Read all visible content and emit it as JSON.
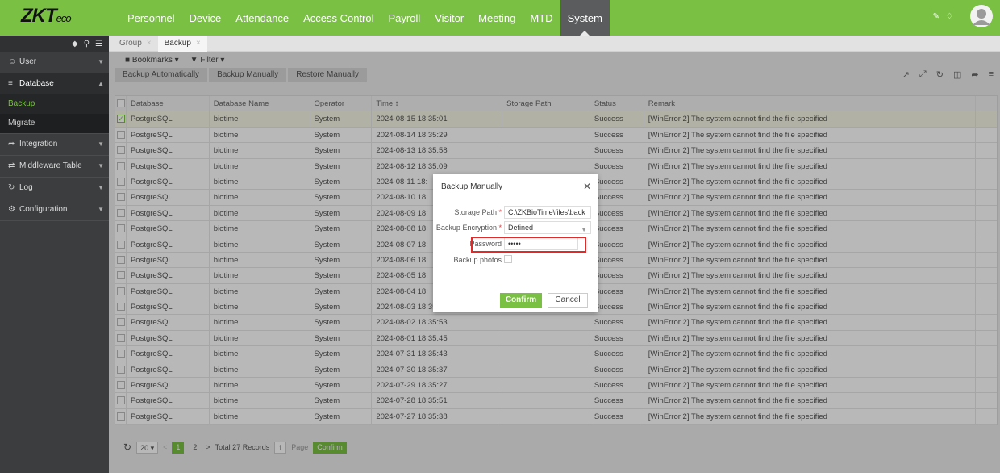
{
  "brand": {
    "logo": "ZKT",
    "logo_suffix": "eco",
    "accent": "#7ac143"
  },
  "nav": [
    {
      "label": "Personnel"
    },
    {
      "label": "Device"
    },
    {
      "label": "Attendance"
    },
    {
      "label": "Access Control"
    },
    {
      "label": "Payroll"
    },
    {
      "label": "Visitor"
    },
    {
      "label": "Meeting"
    },
    {
      "label": "MTD"
    },
    {
      "label": "System",
      "active": true
    }
  ],
  "sidebar": {
    "items": [
      {
        "label": "User",
        "icon": "users-icon"
      },
      {
        "label": "Database",
        "icon": "database-icon",
        "open": true,
        "children": [
          {
            "label": "Backup",
            "active": true
          },
          {
            "label": "Migrate"
          }
        ]
      },
      {
        "label": "Integration",
        "icon": "share-icon"
      },
      {
        "label": "Middleware Table",
        "icon": "exchange-icon"
      },
      {
        "label": "Log",
        "icon": "history-icon"
      },
      {
        "label": "Configuration",
        "icon": "gears-icon"
      }
    ]
  },
  "tabs": [
    {
      "label": "Group"
    },
    {
      "label": "Backup",
      "active": true
    }
  ],
  "toolbar": {
    "bookmarks": "Bookmarks",
    "filter": "Filter"
  },
  "sub_buttons": [
    "Backup Automatically",
    "Backup Manually",
    "Restore Manually"
  ],
  "table": {
    "columns": [
      "Database",
      "Database Name",
      "Operator",
      "Time ↕",
      "Storage Path",
      "Status",
      "Remark"
    ],
    "rows": [
      [
        "PostgreSQL",
        "biotime",
        "System",
        "2024-08-15 18:35:01",
        "",
        "Success",
        "[WinError 2] The system cannot find the file specified"
      ],
      [
        "PostgreSQL",
        "biotime",
        "System",
        "2024-08-14 18:35:29",
        "",
        "Success",
        "[WinError 2] The system cannot find the file specified"
      ],
      [
        "PostgreSQL",
        "biotime",
        "System",
        "2024-08-13 18:35:58",
        "",
        "Success",
        "[WinError 2] The system cannot find the file specified"
      ],
      [
        "PostgreSQL",
        "biotime",
        "System",
        "2024-08-12 18:35:09",
        "",
        "Success",
        "[WinError 2] The system cannot find the file specified"
      ],
      [
        "PostgreSQL",
        "biotime",
        "System",
        "2024-08-11 18:",
        "",
        "Success",
        "[WinError 2] The system cannot find the file specified"
      ],
      [
        "PostgreSQL",
        "biotime",
        "System",
        "2024-08-10 18:",
        "",
        "Success",
        "[WinError 2] The system cannot find the file specified"
      ],
      [
        "PostgreSQL",
        "biotime",
        "System",
        "2024-08-09 18:",
        "",
        "Success",
        "[WinError 2] The system cannot find the file specified"
      ],
      [
        "PostgreSQL",
        "biotime",
        "System",
        "2024-08-08 18:",
        "",
        "Success",
        "[WinError 2] The system cannot find the file specified"
      ],
      [
        "PostgreSQL",
        "biotime",
        "System",
        "2024-08-07 18:",
        "",
        "Success",
        "[WinError 2] The system cannot find the file specified"
      ],
      [
        "PostgreSQL",
        "biotime",
        "System",
        "2024-08-06 18:",
        "",
        "Success",
        "[WinError 2] The system cannot find the file specified"
      ],
      [
        "PostgreSQL",
        "biotime",
        "System",
        "2024-08-05 18:",
        "",
        "Success",
        "[WinError 2] The system cannot find the file specified"
      ],
      [
        "PostgreSQL",
        "biotime",
        "System",
        "2024-08-04 18:",
        "",
        "Success",
        "[WinError 2] The system cannot find the file specified"
      ],
      [
        "PostgreSQL",
        "biotime",
        "System",
        "2024-08-03 18:35:02",
        "",
        "Success",
        "[WinError 2] The system cannot find the file specified"
      ],
      [
        "PostgreSQL",
        "biotime",
        "System",
        "2024-08-02 18:35:53",
        "",
        "Success",
        "[WinError 2] The system cannot find the file specified"
      ],
      [
        "PostgreSQL",
        "biotime",
        "System",
        "2024-08-01 18:35:45",
        "",
        "Success",
        "[WinError 2] The system cannot find the file specified"
      ],
      [
        "PostgreSQL",
        "biotime",
        "System",
        "2024-07-31 18:35:43",
        "",
        "Success",
        "[WinError 2] The system cannot find the file specified"
      ],
      [
        "PostgreSQL",
        "biotime",
        "System",
        "2024-07-30 18:35:37",
        "",
        "Success",
        "[WinError 2] The system cannot find the file specified"
      ],
      [
        "PostgreSQL",
        "biotime",
        "System",
        "2024-07-29 18:35:27",
        "",
        "Success",
        "[WinError 2] The system cannot find the file specified"
      ],
      [
        "PostgreSQL",
        "biotime",
        "System",
        "2024-07-28 18:35:51",
        "",
        "Success",
        "[WinError 2] The system cannot find the file specified"
      ],
      [
        "PostgreSQL",
        "biotime",
        "System",
        "2024-07-27 18:35:38",
        "",
        "Success",
        "[WinError 2] The system cannot find the file specified"
      ]
    ]
  },
  "pager": {
    "page_size": "20",
    "pages": [
      "1",
      "2"
    ],
    "total": "Total 27 Records",
    "page_input": "1",
    "page_label": "Page",
    "confirm": "Confirm"
  },
  "modal": {
    "title": "Backup Manually",
    "storage_path_label": "Storage Path",
    "storage_path_value": "C:\\ZKBioTime\\files\\back",
    "encryption_label": "Backup Encryption",
    "encryption_value": "Defined",
    "password_label": "Password",
    "password_value": "•••••",
    "photos_label": "Backup photos",
    "confirm": "Confirm",
    "cancel": "Cancel"
  }
}
